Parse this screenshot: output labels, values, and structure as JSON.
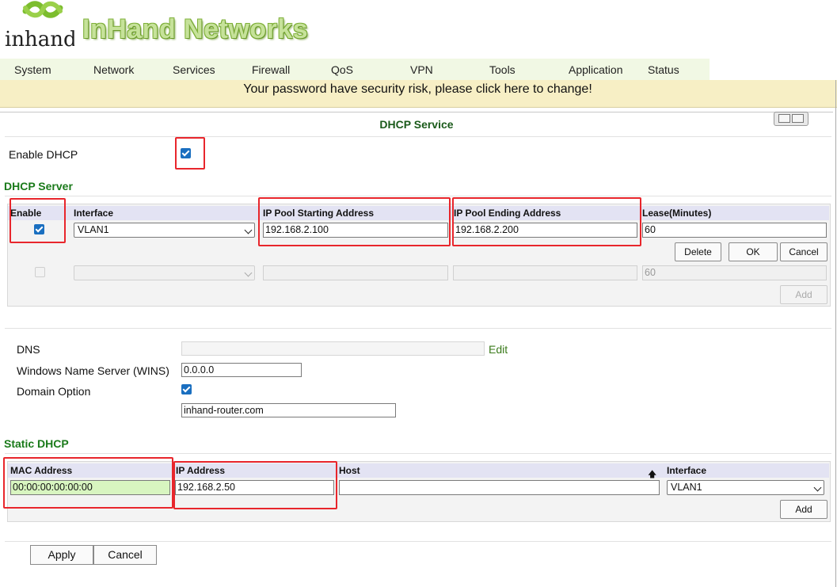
{
  "header": {
    "logo_text": "inhand",
    "brand": "InHand Networks"
  },
  "menu": [
    "System",
    "Network",
    "Services",
    "Firewall",
    "QoS",
    "VPN",
    "Tools",
    "Application",
    "Status"
  ],
  "warning": "Your password have security risk, please click here to change!",
  "section_title": "DHCP Service",
  "enable_dhcp": {
    "label": "Enable DHCP",
    "checked": true
  },
  "dhcp_server": {
    "heading": "DHCP Server",
    "columns": [
      "Enable",
      "Interface",
      "IP Pool Starting Address",
      "IP Pool Ending Address",
      "Lease(Minutes)"
    ],
    "row": {
      "enabled": true,
      "interface": "VLAN1",
      "start": "192.168.2.100",
      "end": "192.168.2.200",
      "lease": "60"
    },
    "new_row": {
      "interface": "",
      "start": "",
      "end": "",
      "lease": "60"
    },
    "buttons": {
      "delete": "Delete",
      "ok": "OK",
      "cancel": "Cancel",
      "add": "Add"
    }
  },
  "dns": {
    "label": "DNS",
    "value": "",
    "edit": "Edit"
  },
  "wins": {
    "label": "Windows Name Server (WINS)",
    "value": "0.0.0.0"
  },
  "domain": {
    "label": "Domain Option",
    "checked": true,
    "value": "inhand-router.com"
  },
  "static_dhcp": {
    "heading": "Static DHCP",
    "columns": [
      "MAC Address",
      "IP Address",
      "Host",
      "Interface"
    ],
    "row": {
      "mac": "00:00:00:00:00:00",
      "ip": "192.168.2.50",
      "host": "",
      "interface": "VLAN1"
    },
    "add": "Add"
  },
  "footer": {
    "apply": "Apply",
    "cancel": "Cancel"
  },
  "colors": {
    "accent_green": "#1a7a1a",
    "highlight_red": "#e8262c",
    "warning_bg": "#f7efc5",
    "menu_bg": "#f1f8e4"
  }
}
